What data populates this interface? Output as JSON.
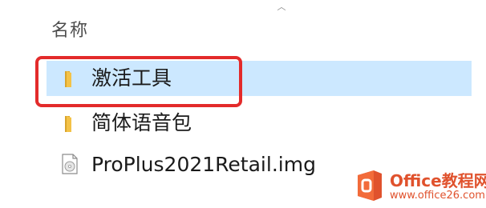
{
  "header": {
    "column_name": "名称",
    "sort_icon": "chevron-up-icon"
  },
  "files": [
    {
      "name": "激活工具",
      "type": "folder",
      "icon": "folder-icon",
      "selected": true
    },
    {
      "name": "简体语音包",
      "type": "folder",
      "icon": "folder-icon",
      "selected": false
    },
    {
      "name": "ProPlus2021Retail.img",
      "type": "disc-image",
      "icon": "disc-image-icon",
      "selected": false
    }
  ],
  "annotation": {
    "highlight_color": "#e32b2b"
  },
  "colors": {
    "selection": "#cce8ff",
    "folder": "#f4c247"
  },
  "watermark": {
    "title": "Office教程网",
    "url": "www.office26.com",
    "icon": "office-logo-icon"
  }
}
